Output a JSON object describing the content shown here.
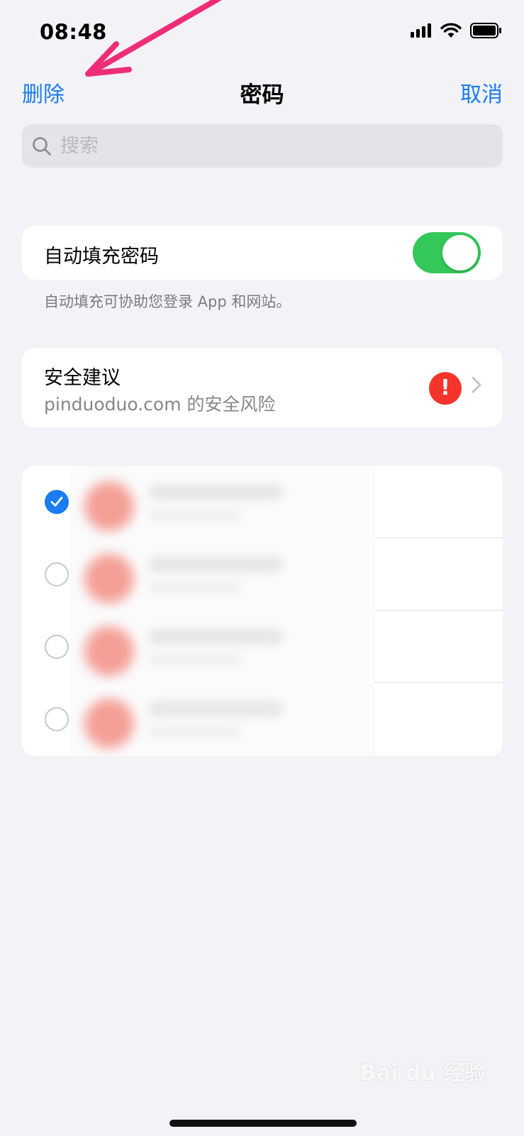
{
  "status_bar": {
    "time": "08:48"
  },
  "nav": {
    "left_button": "删除",
    "title": "密码",
    "right_button": "取消"
  },
  "search": {
    "placeholder": "搜索"
  },
  "autofill": {
    "label": "自动填充密码",
    "enabled": true,
    "footnote": "自动填充可协助您登录 App 和网站。"
  },
  "security": {
    "title": "安全建议",
    "subtitle": "pinduoduo.com 的安全风险",
    "alert_glyph": "!"
  },
  "password_list": {
    "rows": [
      {
        "selected": true
      },
      {
        "selected": false
      },
      {
        "selected": false
      },
      {
        "selected": false
      }
    ]
  },
  "colors": {
    "accent": "#1a7cf0",
    "toggle_on": "#34c759",
    "alert": "#f5352c",
    "annotation_arrow": "#ee2d78"
  },
  "watermark": {
    "text": "Bai du 经验"
  }
}
